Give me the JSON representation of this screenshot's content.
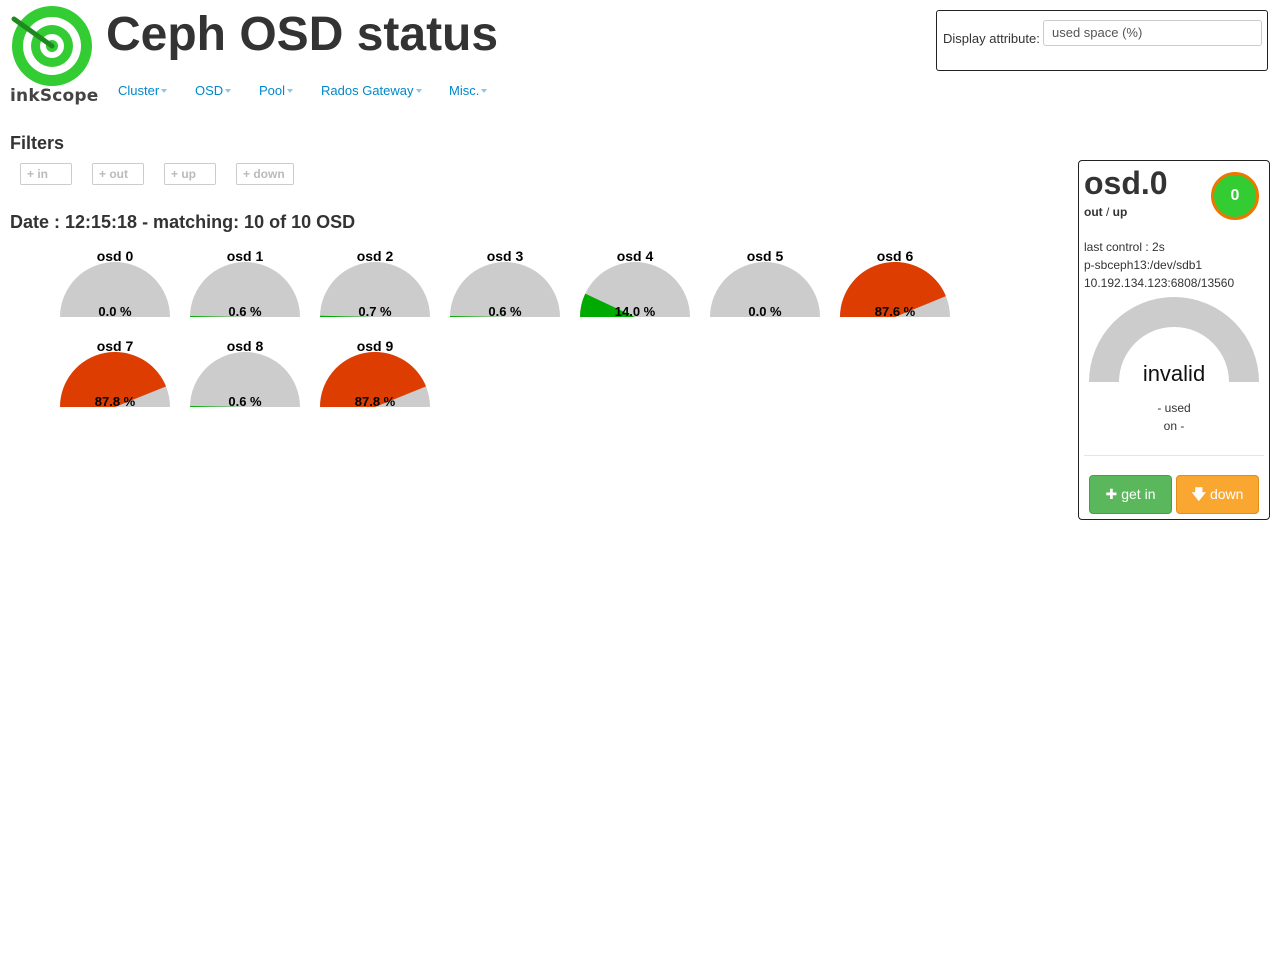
{
  "header": {
    "logo_text": "inkScope",
    "title": "Ceph OSD status"
  },
  "nav": [
    {
      "label": "Cluster"
    },
    {
      "label": "OSD"
    },
    {
      "label": "Pool"
    },
    {
      "label": "Rados Gateway"
    },
    {
      "label": "Misc."
    }
  ],
  "display_attribute": {
    "label": "Display attribute:",
    "value": "used space (%)"
  },
  "filters": {
    "title": "Filters",
    "buttons": [
      "+ in",
      "+ out",
      "+ up",
      "+ down"
    ]
  },
  "date_line": "Date : 12:15:18 - matching: 10 of 10 OSD",
  "osds": [
    {
      "name": "osd 0",
      "value": "0.0 %",
      "used": 0.0,
      "color": "#00aa00"
    },
    {
      "name": "osd 1",
      "value": "0.6 %",
      "used": 0.6,
      "color": "#00aa00"
    },
    {
      "name": "osd 2",
      "value": "0.7 %",
      "used": 0.7,
      "color": "#00aa00"
    },
    {
      "name": "osd 3",
      "value": "0.6 %",
      "used": 0.6,
      "color": "#00aa00"
    },
    {
      "name": "osd 4",
      "value": "14.0 %",
      "used": 14.0,
      "color": "#00aa00"
    },
    {
      "name": "osd 5",
      "value": "0.0 %",
      "used": 0.0,
      "color": "#00aa00"
    },
    {
      "name": "osd 6",
      "value": "87.6 %",
      "used": 87.6,
      "color": "#dd3d00"
    },
    {
      "name": "osd 7",
      "value": "87.8 %",
      "used": 87.8,
      "color": "#dd3d00"
    },
    {
      "name": "osd 8",
      "value": "0.6 %",
      "used": 0.6,
      "color": "#00aa00"
    },
    {
      "name": "osd 9",
      "value": "87.8 %",
      "used": 87.8,
      "color": "#dd3d00"
    }
  ],
  "gauge_bg_color": "#cccccc",
  "detail": {
    "name": "osd.0",
    "state_out": "out",
    "state_sep": " / ",
    "state_up": "up",
    "badge": "0",
    "last_control": "last control : 2s",
    "device": "p-sbceph13:/dev/sdb1",
    "address": "10.192.134.123:6808/13560",
    "gauge_text": "invalid",
    "used_line": "- used",
    "on_line": "on -",
    "btn_in": "get in",
    "btn_down": "down"
  }
}
